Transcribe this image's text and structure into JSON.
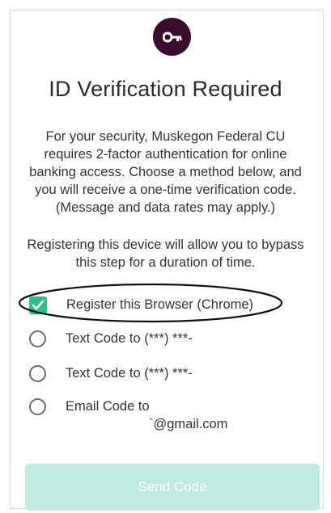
{
  "header": {
    "icon": "key-icon",
    "title": "ID Verification Required"
  },
  "intro_text": "For your security, Muskegon Federal CU requires 2-factor authentication for online banking access. Choose a method below, and you will receive a one-time verification code. (Message and data rates may apply.)",
  "device_note": "Registering this device will allow you to bypass this step for a duration of time.",
  "options": [
    {
      "label": "Register this Browser (Chrome)",
      "checked": true
    },
    {
      "label": "Text Code to (***) ***-",
      "checked": false
    },
    {
      "label": "Text Code to (***) ***-",
      "checked": false
    },
    {
      "label": "Email Code to",
      "sublabel": "`@gmail.com",
      "checked": false
    }
  ],
  "send_button": {
    "label": "Send Code"
  },
  "colors": {
    "badge": "#3a0d2e",
    "check": "#2fbf8f",
    "button_disabled": "#bfeae0"
  }
}
